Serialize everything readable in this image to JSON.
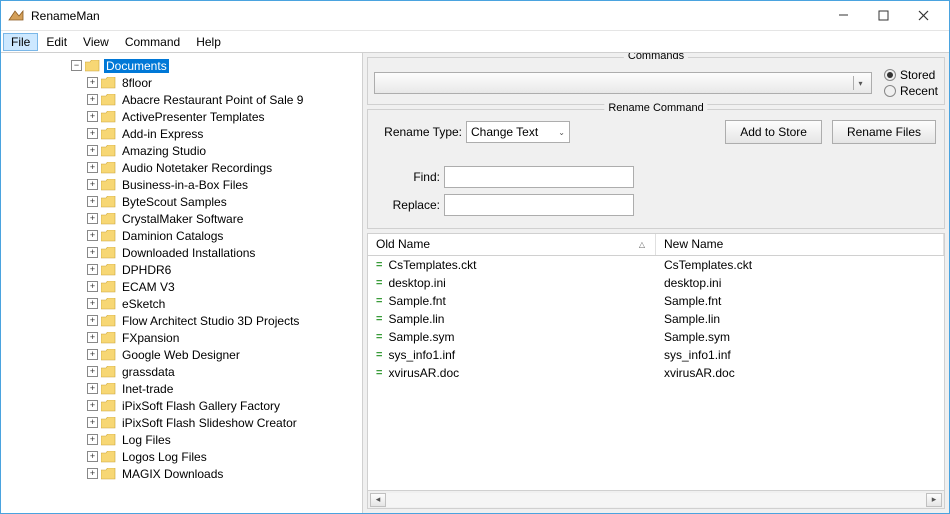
{
  "window": {
    "title": "RenameMan"
  },
  "menu": {
    "items": [
      "File",
      "Edit",
      "View",
      "Command",
      "Help"
    ],
    "active_index": 0
  },
  "tree": {
    "root": "Documents",
    "children": [
      "8floor",
      "Abacre Restaurant Point of Sale 9",
      "ActivePresenter Templates",
      "Add-in Express",
      "Amazing Studio",
      "Audio Notetaker Recordings",
      "Business-in-a-Box Files",
      "ByteScout Samples",
      "CrystalMaker Software",
      "Daminion Catalogs",
      "Downloaded Installations",
      "DPHDR6",
      "ECAM V3",
      "eSketch",
      "Flow Architect Studio 3D Projects",
      "FXpansion",
      "Google Web Designer",
      "grassdata",
      "Inet-trade",
      "iPixSoft Flash Gallery Factory",
      "iPixSoft Flash Slideshow Creator",
      "Log Files",
      "Logos Log Files",
      "MAGIX Downloads"
    ]
  },
  "commands": {
    "group_label": "Commands",
    "radio": {
      "stored": "Stored",
      "recent": "Recent",
      "selected": "stored"
    }
  },
  "rename": {
    "group_label": "Rename Command",
    "type_label": "Rename Type:",
    "type_value": "Change Text",
    "add_to_store": "Add to Store",
    "rename_files": "Rename Files",
    "find_label": "Find:",
    "replace_label": "Replace:",
    "find_value": "",
    "replace_value": ""
  },
  "table": {
    "old_header": "Old Name",
    "new_header": "New Name",
    "rows": [
      {
        "old": "CsTemplates.ckt",
        "new": "CsTemplates.ckt"
      },
      {
        "old": "desktop.ini",
        "new": "desktop.ini"
      },
      {
        "old": "Sample.fnt",
        "new": "Sample.fnt"
      },
      {
        "old": "Sample.lin",
        "new": "Sample.lin"
      },
      {
        "old": "Sample.sym",
        "new": "Sample.sym"
      },
      {
        "old": "sys_info1.inf",
        "new": "sys_info1.inf"
      },
      {
        "old": "xvirusAR.doc",
        "new": "xvirusAR.doc"
      }
    ]
  }
}
